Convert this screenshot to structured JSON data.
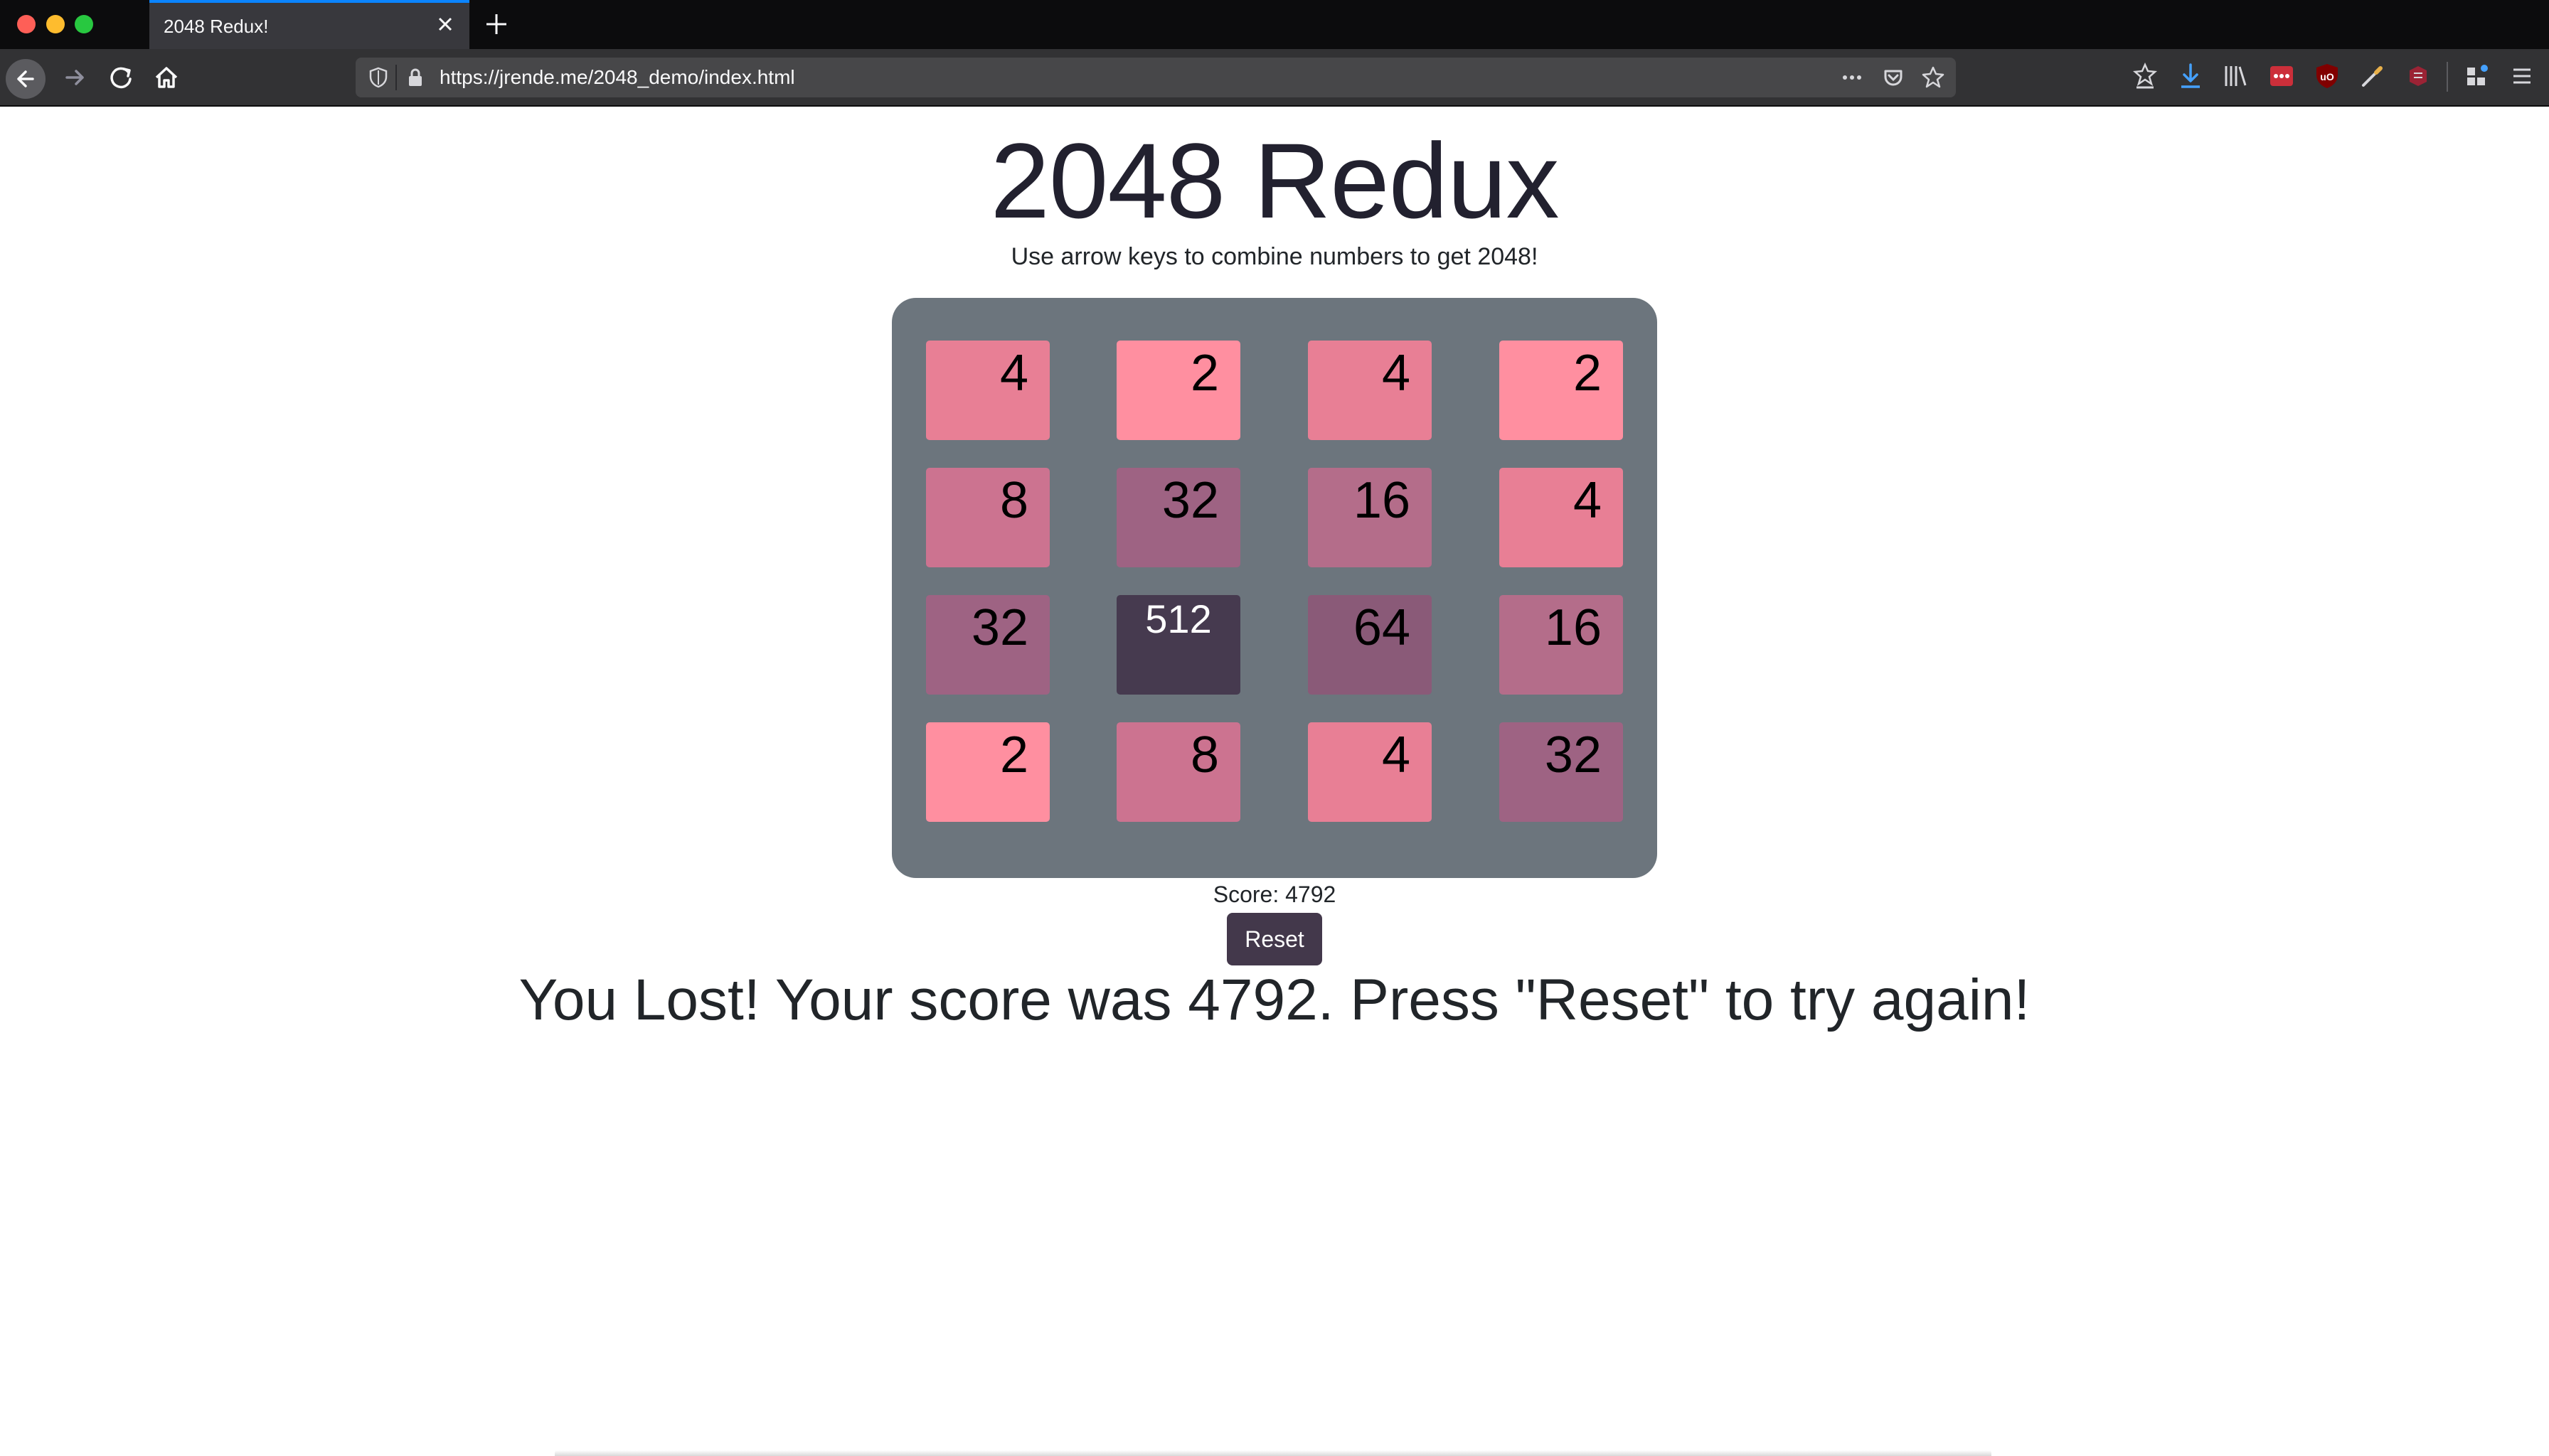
{
  "browser": {
    "tab": {
      "title": "2048 Redux!"
    },
    "url": "https://jrende.me/2048_demo/index.html"
  },
  "page": {
    "title": "2048 Redux",
    "subtitle": "Use arrow keys to combine numbers to get 2048!",
    "score_label": "Score: 4792",
    "reset_label": "Reset",
    "lost_message": "You Lost! Your score was 4792. Press \"Reset\" to try again!"
  },
  "board": {
    "rows": [
      [
        4,
        2,
        4,
        2
      ],
      [
        8,
        32,
        16,
        4
      ],
      [
        32,
        512,
        64,
        16
      ],
      [
        2,
        8,
        4,
        32
      ]
    ],
    "tile_colors": {
      "2": "#ff8fa0",
      "4": "#e87f95",
      "8": "#cc7390",
      "16": "#b46d8a",
      "32": "#9e6383",
      "64": "#8a5a78",
      "512": "#463a4f"
    },
    "tile_text_colors": {
      "512": "#ffffff"
    }
  },
  "colors": {
    "board_bg": "#6c757d",
    "reset_bg": "#43384b",
    "text_dark": "#212529"
  }
}
